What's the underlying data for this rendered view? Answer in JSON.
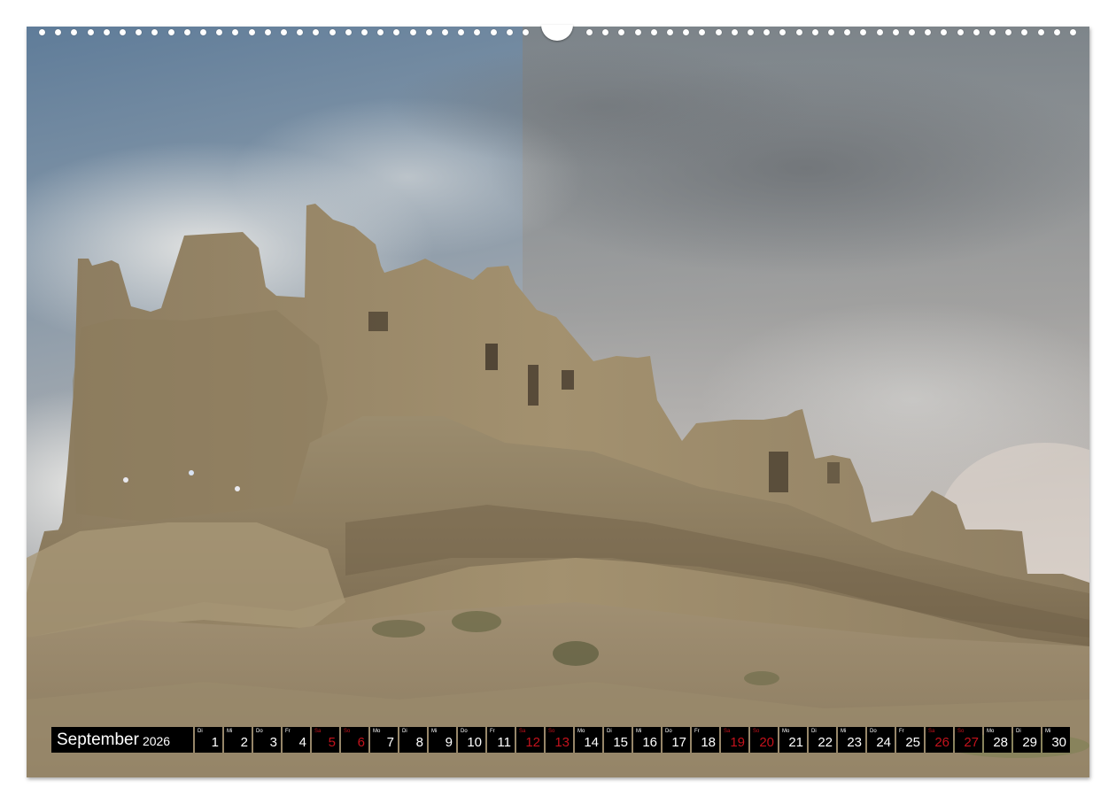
{
  "calendar": {
    "month": "September",
    "year": "2026",
    "days": [
      {
        "wd": "Di",
        "n": "1",
        "weekend": false
      },
      {
        "wd": "Mi",
        "n": "2",
        "weekend": false
      },
      {
        "wd": "Do",
        "n": "3",
        "weekend": false
      },
      {
        "wd": "Fr",
        "n": "4",
        "weekend": false
      },
      {
        "wd": "Sa",
        "n": "5",
        "weekend": true
      },
      {
        "wd": "So",
        "n": "6",
        "weekend": true
      },
      {
        "wd": "Mo",
        "n": "7",
        "weekend": false
      },
      {
        "wd": "Di",
        "n": "8",
        "weekend": false
      },
      {
        "wd": "Mi",
        "n": "9",
        "weekend": false
      },
      {
        "wd": "Do",
        "n": "10",
        "weekend": false
      },
      {
        "wd": "Fr",
        "n": "11",
        "weekend": false
      },
      {
        "wd": "Sa",
        "n": "12",
        "weekend": true
      },
      {
        "wd": "So",
        "n": "13",
        "weekend": true
      },
      {
        "wd": "Mo",
        "n": "14",
        "weekend": false
      },
      {
        "wd": "Di",
        "n": "15",
        "weekend": false
      },
      {
        "wd": "Mi",
        "n": "16",
        "weekend": false
      },
      {
        "wd": "Do",
        "n": "17",
        "weekend": false
      },
      {
        "wd": "Fr",
        "n": "18",
        "weekend": false
      },
      {
        "wd": "Sa",
        "n": "19",
        "weekend": true
      },
      {
        "wd": "So",
        "n": "20",
        "weekend": true
      },
      {
        "wd": "Mo",
        "n": "21",
        "weekend": false
      },
      {
        "wd": "Di",
        "n": "22",
        "weekend": false
      },
      {
        "wd": "Mi",
        "n": "23",
        "weekend": false
      },
      {
        "wd": "Do",
        "n": "24",
        "weekend": false
      },
      {
        "wd": "Fr",
        "n": "25",
        "weekend": false
      },
      {
        "wd": "Sa",
        "n": "26",
        "weekend": true
      },
      {
        "wd": "So",
        "n": "27",
        "weekend": true
      },
      {
        "wd": "Mo",
        "n": "28",
        "weekend": false
      },
      {
        "wd": "Di",
        "n": "29",
        "weekend": false
      },
      {
        "wd": "Mi",
        "n": "30",
        "weekend": false
      }
    ]
  },
  "colors": {
    "weekend": "#c4121c",
    "bar": "#000000",
    "sky_top": "#5e7a97",
    "rock": "#9a8a6c"
  }
}
